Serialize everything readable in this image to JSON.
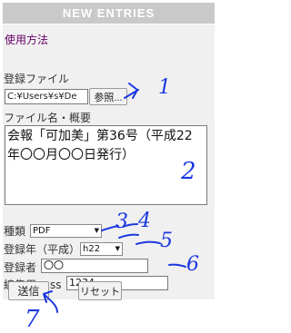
{
  "header": {
    "title": "NEW ENTRIES"
  },
  "usage_link": "使用方法",
  "file": {
    "label": "登録ファイル",
    "path_value": "C:¥Users¥s¥De",
    "browse_button": "参照..."
  },
  "description": {
    "label": "ファイル名・概要",
    "value": "会報「可加美」第36号（平成22年〇〇月〇〇日発行）"
  },
  "fields": {
    "type_label": "種類",
    "type_value": "PDF",
    "year_label": "登録年（平成）",
    "year_value": "h22",
    "registrant_label": "登録者",
    "registrant_value": "〇〇",
    "editpass_label": "編集用pass",
    "editpass_value": "1234"
  },
  "actions": {
    "submit": "送信",
    "reset": "リセット"
  },
  "annotations": [
    "1",
    "2",
    "3",
    "4",
    "5",
    "6",
    "7"
  ],
  "colors": {
    "annotation_ink": "#1a37e0",
    "link": "#660066",
    "header_bg": "#c9c9c9"
  }
}
